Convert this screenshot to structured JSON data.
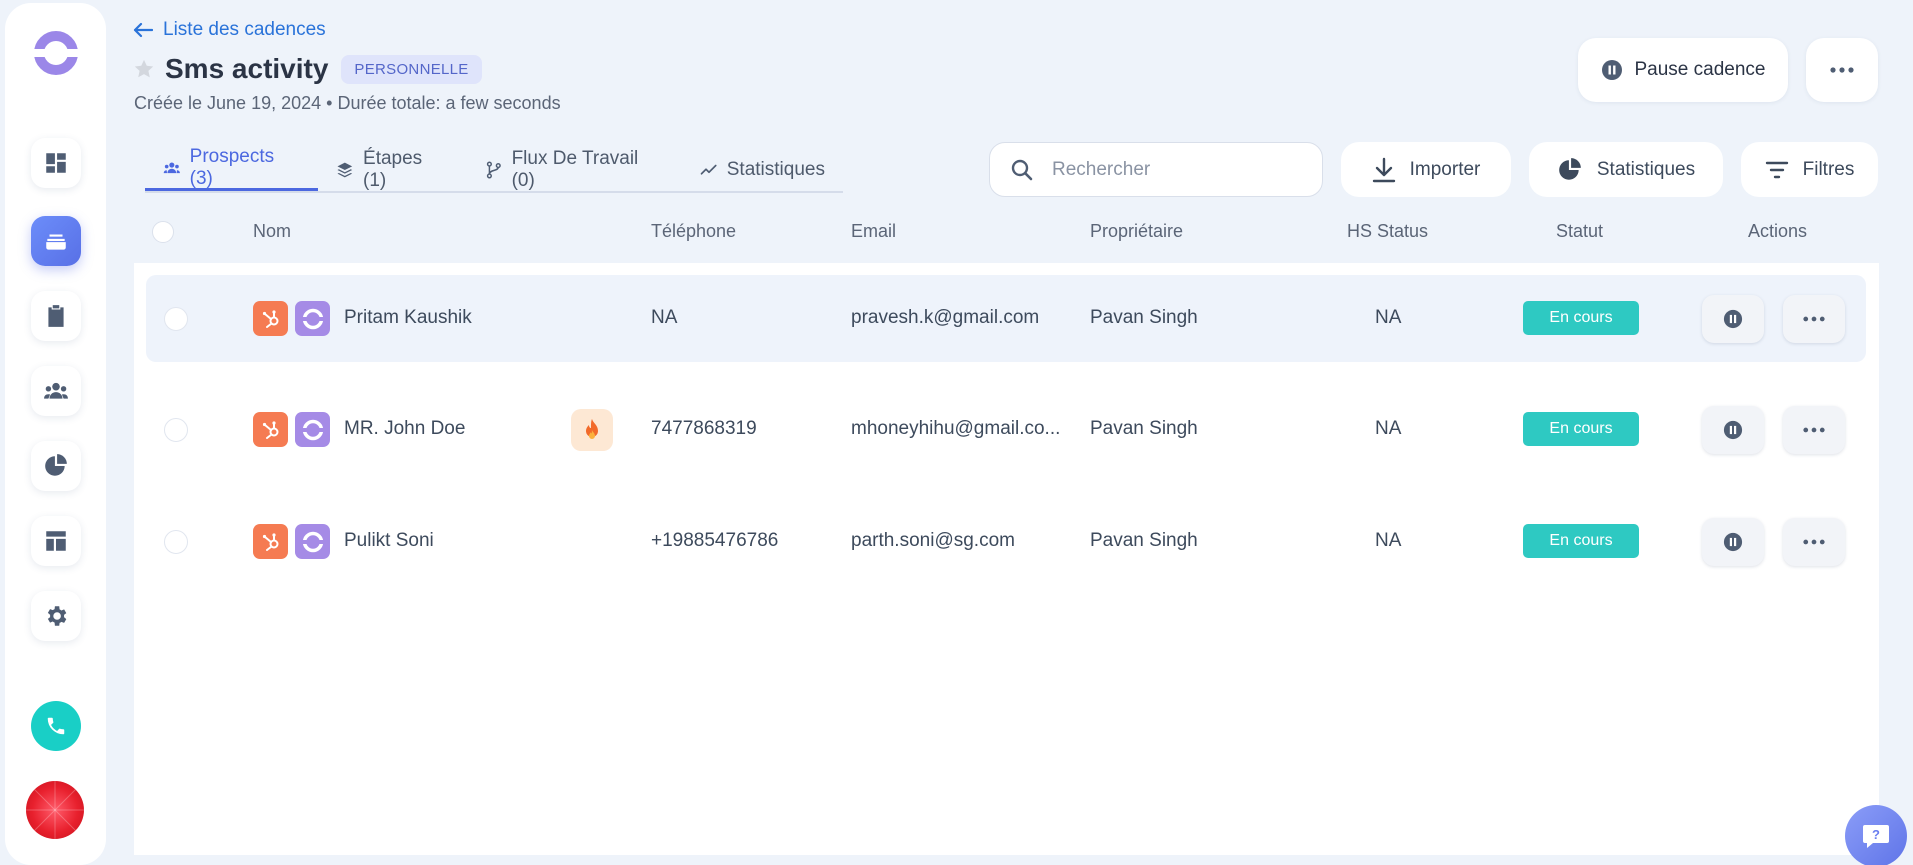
{
  "header": {
    "back_label": "Liste des cadences",
    "title": "Sms activity",
    "badge": "PERSONNELLE",
    "subtitle_created": "Créée le June 19, 2024",
    "subtitle_sep": " • ",
    "subtitle_duration": "Durée totale: a few seconds",
    "pause_label": "Pause cadence"
  },
  "tabs": [
    {
      "label": "Prospects (3)",
      "icon": "people-icon",
      "active": true
    },
    {
      "label": "Étapes (1)",
      "icon": "layers-icon",
      "active": false
    },
    {
      "label": "Flux De Travail (0)",
      "icon": "branch-icon",
      "active": false
    },
    {
      "label": "Statistiques",
      "icon": "trend-icon",
      "active": false
    }
  ],
  "toolbar": {
    "search_placeholder": "Rechercher",
    "import_label": "Importer",
    "stats_label": "Statistiques",
    "filters_label": "Filtres"
  },
  "table": {
    "columns": [
      "Nom",
      "Téléphone",
      "Email",
      "Propriétaire",
      "HS Status",
      "Statut",
      "Actions"
    ],
    "rows": [
      {
        "name": "Pritam Kaushik",
        "phone": "NA",
        "email": "pravesh.k@gmail.com",
        "owner": "Pavan Singh",
        "hs_status": "NA",
        "status": "En cours",
        "hot": false
      },
      {
        "name": "MR. John Doe",
        "phone": "7477868319",
        "email": "mhoneyhihu@gmail.co...",
        "owner": "Pavan Singh",
        "hs_status": "NA",
        "status": "En cours",
        "hot": true
      },
      {
        "name": "Pulikt Soni",
        "phone": "+19885476786",
        "email": "parth.soni@sg.com",
        "owner": "Pavan Singh",
        "hs_status": "NA",
        "status": "En cours",
        "hot": false
      }
    ]
  },
  "colors": {
    "accent": "#4c68e0",
    "link": "#2a73d9",
    "status": "#2ec9c2",
    "hubspot": "#f57b52",
    "cadence": "#a58be6",
    "call": "#19cfc6"
  }
}
